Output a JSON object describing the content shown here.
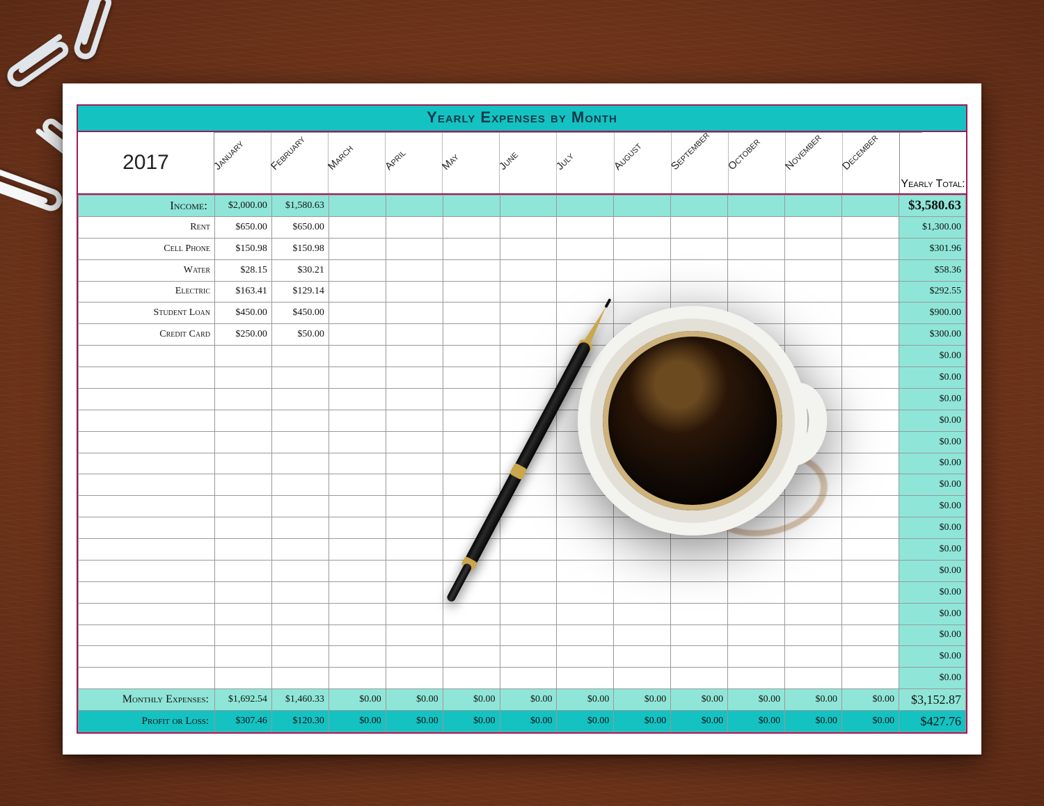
{
  "title": "Yearly Expenses by Month",
  "year": "2017",
  "yearly_total_label": "Yearly Total:",
  "months": [
    "January",
    "February",
    "March",
    "April",
    "May",
    "June",
    "July",
    "August",
    "September",
    "October",
    "November",
    "December"
  ],
  "income": {
    "label": "Income:",
    "values": [
      "$2,000.00",
      "$1,580.63",
      "",
      "",
      "",
      "",
      "",
      "",
      "",
      "",
      "",
      ""
    ],
    "yearly": "$3,580.63"
  },
  "expense_rows": [
    {
      "label": "Rent",
      "values": [
        "$650.00",
        "$650.00",
        "",
        "",
        "",
        "",
        "",
        "",
        "",
        "",
        "",
        ""
      ],
      "yearly": "$1,300.00"
    },
    {
      "label": "Cell Phone",
      "values": [
        "$150.98",
        "$150.98",
        "",
        "",
        "",
        "",
        "",
        "",
        "",
        "",
        "",
        ""
      ],
      "yearly": "$301.96"
    },
    {
      "label": "Water",
      "values": [
        "$28.15",
        "$30.21",
        "",
        "",
        "",
        "",
        "",
        "",
        "",
        "",
        "",
        ""
      ],
      "yearly": "$58.36"
    },
    {
      "label": "Electric",
      "values": [
        "$163.41",
        "$129.14",
        "",
        "",
        "",
        "",
        "",
        "",
        "",
        "",
        "",
        ""
      ],
      "yearly": "$292.55"
    },
    {
      "label": "Student Loan",
      "values": [
        "$450.00",
        "$450.00",
        "",
        "",
        "",
        "",
        "",
        "",
        "",
        "",
        "",
        ""
      ],
      "yearly": "$900.00"
    },
    {
      "label": "Credit Card",
      "values": [
        "$250.00",
        "$50.00",
        "",
        "",
        "",
        "",
        "",
        "",
        "",
        "",
        "",
        ""
      ],
      "yearly": "$300.00"
    }
  ],
  "blank_rows": 16,
  "blank_yearly": "$0.00",
  "monthly_expenses": {
    "label": "Monthly Expenses:",
    "values": [
      "$1,692.54",
      "$1,460.33",
      "$0.00",
      "$0.00",
      "$0.00",
      "$0.00",
      "$0.00",
      "$0.00",
      "$0.00",
      "$0.00",
      "$0.00",
      "$0.00"
    ],
    "yearly": "$3,152.87"
  },
  "profit_loss": {
    "label": "Profit or Loss:",
    "values": [
      "$307.46",
      "$120.30",
      "$0.00",
      "$0.00",
      "$0.00",
      "$0.00",
      "$0.00",
      "$0.00",
      "$0.00",
      "$0.00",
      "$0.00",
      "$0.00"
    ],
    "yearly": "$427.76"
  },
  "chart_data": {
    "type": "table",
    "title": "Yearly Expenses by Month",
    "year": 2017,
    "columns": [
      "January",
      "February",
      "March",
      "April",
      "May",
      "June",
      "July",
      "August",
      "September",
      "October",
      "November",
      "December",
      "Yearly Total"
    ],
    "rows": [
      {
        "name": "Income",
        "values": [
          2000.0,
          1580.63,
          null,
          null,
          null,
          null,
          null,
          null,
          null,
          null,
          null,
          null
        ],
        "yearly_total": 3580.63
      },
      {
        "name": "Rent",
        "values": [
          650.0,
          650.0,
          null,
          null,
          null,
          null,
          null,
          null,
          null,
          null,
          null,
          null
        ],
        "yearly_total": 1300.0
      },
      {
        "name": "Cell Phone",
        "values": [
          150.98,
          150.98,
          null,
          null,
          null,
          null,
          null,
          null,
          null,
          null,
          null,
          null
        ],
        "yearly_total": 301.96
      },
      {
        "name": "Water",
        "values": [
          28.15,
          30.21,
          null,
          null,
          null,
          null,
          null,
          null,
          null,
          null,
          null,
          null
        ],
        "yearly_total": 58.36
      },
      {
        "name": "Electric",
        "values": [
          163.41,
          129.14,
          null,
          null,
          null,
          null,
          null,
          null,
          null,
          null,
          null,
          null
        ],
        "yearly_total": 292.55
      },
      {
        "name": "Student Loan",
        "values": [
          450.0,
          450.0,
          null,
          null,
          null,
          null,
          null,
          null,
          null,
          null,
          null,
          null
        ],
        "yearly_total": 900.0
      },
      {
        "name": "Credit Card",
        "values": [
          250.0,
          50.0,
          null,
          null,
          null,
          null,
          null,
          null,
          null,
          null,
          null,
          null
        ],
        "yearly_total": 300.0
      },
      {
        "name": "Monthly Expenses",
        "values": [
          1692.54,
          1460.33,
          0,
          0,
          0,
          0,
          0,
          0,
          0,
          0,
          0,
          0
        ],
        "yearly_total": 3152.87
      },
      {
        "name": "Profit or Loss",
        "values": [
          307.46,
          120.3,
          0,
          0,
          0,
          0,
          0,
          0,
          0,
          0,
          0,
          0
        ],
        "yearly_total": 427.76
      }
    ]
  }
}
